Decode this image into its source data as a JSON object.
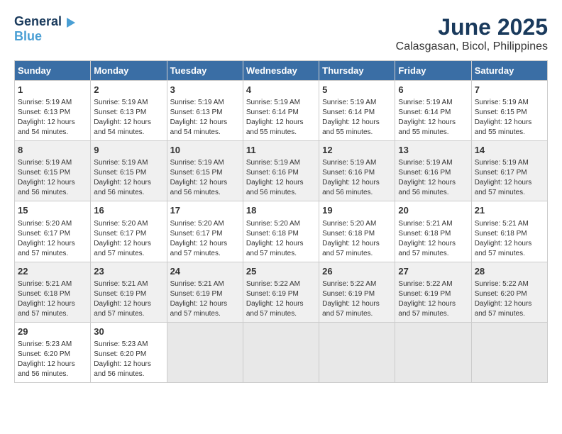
{
  "header": {
    "logo_line1": "General",
    "logo_line2": "Blue",
    "title": "June 2025",
    "subtitle": "Calasgasan, Bicol, Philippines"
  },
  "calendar": {
    "days_of_week": [
      "Sunday",
      "Monday",
      "Tuesday",
      "Wednesday",
      "Thursday",
      "Friday",
      "Saturday"
    ],
    "weeks": [
      [
        null,
        null,
        null,
        null,
        null,
        null,
        null
      ]
    ]
  },
  "cells": {
    "w1": [
      {
        "day": "",
        "empty": true
      },
      {
        "day": "",
        "empty": true
      },
      {
        "day": "",
        "empty": true
      },
      {
        "day": "",
        "empty": true
      },
      {
        "day": "",
        "empty": true
      },
      {
        "day": "",
        "empty": true
      },
      {
        "day": "7",
        "rise": "Sunrise: 5:19 AM",
        "set": "Sunset: 6:15 PM",
        "daylight": "Daylight: 12 hours and 55 minutes."
      }
    ],
    "w2": [
      {
        "day": "1",
        "rise": "Sunrise: 5:19 AM",
        "set": "Sunset: 6:13 PM",
        "daylight": "Daylight: 12 hours and 54 minutes."
      },
      {
        "day": "2",
        "rise": "Sunrise: 5:19 AM",
        "set": "Sunset: 6:13 PM",
        "daylight": "Daylight: 12 hours and 54 minutes."
      },
      {
        "day": "3",
        "rise": "Sunrise: 5:19 AM",
        "set": "Sunset: 6:13 PM",
        "daylight": "Daylight: 12 hours and 54 minutes."
      },
      {
        "day": "4",
        "rise": "Sunrise: 5:19 AM",
        "set": "Sunset: 6:14 PM",
        "daylight": "Daylight: 12 hours and 55 minutes."
      },
      {
        "day": "5",
        "rise": "Sunrise: 5:19 AM",
        "set": "Sunset: 6:14 PM",
        "daylight": "Daylight: 12 hours and 55 minutes."
      },
      {
        "day": "6",
        "rise": "Sunrise: 5:19 AM",
        "set": "Sunset: 6:14 PM",
        "daylight": "Daylight: 12 hours and 55 minutes."
      },
      {
        "day": "7",
        "rise": "Sunrise: 5:19 AM",
        "set": "Sunset: 6:15 PM",
        "daylight": "Daylight: 12 hours and 55 minutes."
      }
    ],
    "w3": [
      {
        "day": "8",
        "rise": "Sunrise: 5:19 AM",
        "set": "Sunset: 6:15 PM",
        "daylight": "Daylight: 12 hours and 56 minutes."
      },
      {
        "day": "9",
        "rise": "Sunrise: 5:19 AM",
        "set": "Sunset: 6:15 PM",
        "daylight": "Daylight: 12 hours and 56 minutes."
      },
      {
        "day": "10",
        "rise": "Sunrise: 5:19 AM",
        "set": "Sunset: 6:15 PM",
        "daylight": "Daylight: 12 hours and 56 minutes."
      },
      {
        "day": "11",
        "rise": "Sunrise: 5:19 AM",
        "set": "Sunset: 6:16 PM",
        "daylight": "Daylight: 12 hours and 56 minutes."
      },
      {
        "day": "12",
        "rise": "Sunrise: 5:19 AM",
        "set": "Sunset: 6:16 PM",
        "daylight": "Daylight: 12 hours and 56 minutes."
      },
      {
        "day": "13",
        "rise": "Sunrise: 5:19 AM",
        "set": "Sunset: 6:16 PM",
        "daylight": "Daylight: 12 hours and 56 minutes."
      },
      {
        "day": "14",
        "rise": "Sunrise: 5:19 AM",
        "set": "Sunset: 6:17 PM",
        "daylight": "Daylight: 12 hours and 57 minutes."
      }
    ],
    "w4": [
      {
        "day": "15",
        "rise": "Sunrise: 5:20 AM",
        "set": "Sunset: 6:17 PM",
        "daylight": "Daylight: 12 hours and 57 minutes."
      },
      {
        "day": "16",
        "rise": "Sunrise: 5:20 AM",
        "set": "Sunset: 6:17 PM",
        "daylight": "Daylight: 12 hours and 57 minutes."
      },
      {
        "day": "17",
        "rise": "Sunrise: 5:20 AM",
        "set": "Sunset: 6:17 PM",
        "daylight": "Daylight: 12 hours and 57 minutes."
      },
      {
        "day": "18",
        "rise": "Sunrise: 5:20 AM",
        "set": "Sunset: 6:18 PM",
        "daylight": "Daylight: 12 hours and 57 minutes."
      },
      {
        "day": "19",
        "rise": "Sunrise: 5:20 AM",
        "set": "Sunset: 6:18 PM",
        "daylight": "Daylight: 12 hours and 57 minutes."
      },
      {
        "day": "20",
        "rise": "Sunrise: 5:21 AM",
        "set": "Sunset: 6:18 PM",
        "daylight": "Daylight: 12 hours and 57 minutes."
      },
      {
        "day": "21",
        "rise": "Sunrise: 5:21 AM",
        "set": "Sunset: 6:18 PM",
        "daylight": "Daylight: 12 hours and 57 minutes."
      }
    ],
    "w5": [
      {
        "day": "22",
        "rise": "Sunrise: 5:21 AM",
        "set": "Sunset: 6:18 PM",
        "daylight": "Daylight: 12 hours and 57 minutes."
      },
      {
        "day": "23",
        "rise": "Sunrise: 5:21 AM",
        "set": "Sunset: 6:19 PM",
        "daylight": "Daylight: 12 hours and 57 minutes."
      },
      {
        "day": "24",
        "rise": "Sunrise: 5:21 AM",
        "set": "Sunset: 6:19 PM",
        "daylight": "Daylight: 12 hours and 57 minutes."
      },
      {
        "day": "25",
        "rise": "Sunrise: 5:22 AM",
        "set": "Sunset: 6:19 PM",
        "daylight": "Daylight: 12 hours and 57 minutes."
      },
      {
        "day": "26",
        "rise": "Sunrise: 5:22 AM",
        "set": "Sunset: 6:19 PM",
        "daylight": "Daylight: 12 hours and 57 minutes."
      },
      {
        "day": "27",
        "rise": "Sunrise: 5:22 AM",
        "set": "Sunset: 6:19 PM",
        "daylight": "Daylight: 12 hours and 57 minutes."
      },
      {
        "day": "28",
        "rise": "Sunrise: 5:22 AM",
        "set": "Sunset: 6:20 PM",
        "daylight": "Daylight: 12 hours and 57 minutes."
      }
    ],
    "w6": [
      {
        "day": "29",
        "rise": "Sunrise: 5:23 AM",
        "set": "Sunset: 6:20 PM",
        "daylight": "Daylight: 12 hours and 56 minutes."
      },
      {
        "day": "30",
        "rise": "Sunrise: 5:23 AM",
        "set": "Sunset: 6:20 PM",
        "daylight": "Daylight: 12 hours and 56 minutes."
      },
      {
        "day": "",
        "empty": true
      },
      {
        "day": "",
        "empty": true
      },
      {
        "day": "",
        "empty": true
      },
      {
        "day": "",
        "empty": true
      },
      {
        "day": "",
        "empty": true
      }
    ]
  }
}
